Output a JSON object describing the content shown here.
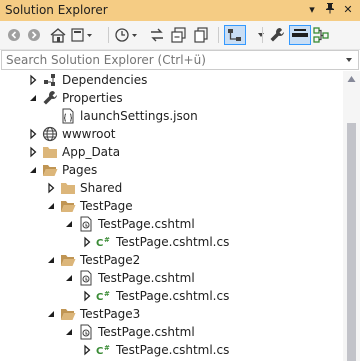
{
  "window": {
    "title": "Solution Explorer"
  },
  "search": {
    "placeholder": "Search Solution Explorer (Ctrl+ü)"
  },
  "tree": [
    {
      "label": "Dependencies",
      "depth": 1,
      "expander": "collapsed",
      "icon": "dependencies-icon"
    },
    {
      "label": "Properties",
      "depth": 1,
      "expander": "expanded",
      "icon": "wrench-icon"
    },
    {
      "label": "launchSettings.json",
      "depth": 2,
      "expander": "none",
      "icon": "json-file-icon"
    },
    {
      "label": "wwwroot",
      "depth": 1,
      "expander": "collapsed",
      "icon": "globe-icon"
    },
    {
      "label": "App_Data",
      "depth": 1,
      "expander": "collapsed",
      "icon": "folder-icon"
    },
    {
      "label": "Pages",
      "depth": 1,
      "expander": "expanded",
      "icon": "folder-open-icon"
    },
    {
      "label": "Shared",
      "depth": 2,
      "expander": "collapsed",
      "icon": "folder-icon"
    },
    {
      "label": "TestPage",
      "depth": 2,
      "expander": "expanded",
      "icon": "folder-open-icon"
    },
    {
      "label": "TestPage.cshtml",
      "depth": 3,
      "expander": "expanded",
      "icon": "razor-file-icon"
    },
    {
      "label": "TestPage.cshtml.cs",
      "depth": 4,
      "expander": "collapsed",
      "icon": "csharp-file-icon"
    },
    {
      "label": "TestPage2",
      "depth": 2,
      "expander": "expanded",
      "icon": "folder-open-icon"
    },
    {
      "label": "TestPage.cshtml",
      "depth": 3,
      "expander": "expanded",
      "icon": "razor-file-icon"
    },
    {
      "label": "TestPage.cshtml.cs",
      "depth": 4,
      "expander": "collapsed",
      "icon": "csharp-file-icon"
    },
    {
      "label": "TestPage3",
      "depth": 2,
      "expander": "expanded",
      "icon": "folder-open-icon"
    },
    {
      "label": "TestPage.cshtml",
      "depth": 3,
      "expander": "expanded",
      "icon": "razor-file-icon"
    },
    {
      "label": "TestPage.cshtml.cs",
      "depth": 4,
      "expander": "collapsed",
      "icon": "csharp-file-icon"
    }
  ],
  "colors": {
    "titlebar": "#f5cc84",
    "folder": "#dcb67a",
    "csharp": "#388a34",
    "accent": "#3399ff"
  }
}
